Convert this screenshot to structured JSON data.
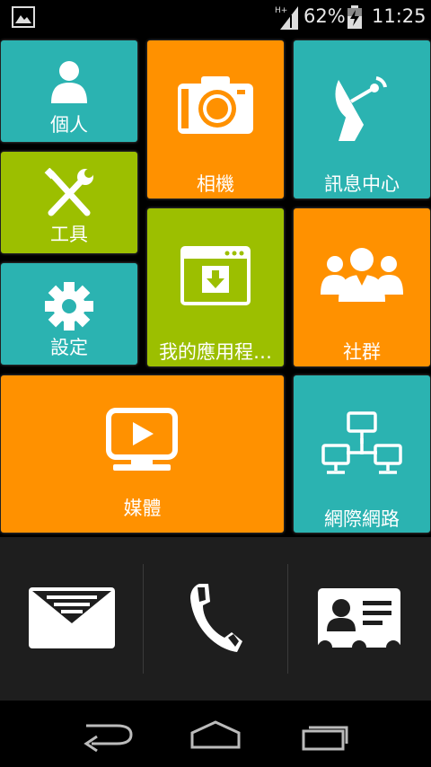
{
  "status_bar": {
    "network_type": "H+",
    "battery_percent": "62%",
    "time": "11:25"
  },
  "tiles": {
    "personal": {
      "label": "個人",
      "icon": "person-icon"
    },
    "camera": {
      "label": "相機",
      "icon": "camera-icon"
    },
    "messages": {
      "label": "訊息中心",
      "icon": "satellite-dish-icon"
    },
    "tools": {
      "label": "工具",
      "icon": "wrench-screwdriver-icon"
    },
    "my_apps": {
      "label": "我的應用程…",
      "icon": "download-window-icon"
    },
    "settings": {
      "label": "設定",
      "icon": "gear-icon"
    },
    "community": {
      "label": "社群",
      "icon": "group-icon"
    },
    "media": {
      "label": "媒體",
      "icon": "play-monitor-icon"
    },
    "network": {
      "label": "網際網路",
      "icon": "network-icon"
    }
  },
  "dock": {
    "items": [
      {
        "name": "messages",
        "icon": "envelope-icon"
      },
      {
        "name": "phone",
        "icon": "phone-icon"
      },
      {
        "name": "contacts",
        "icon": "contact-card-icon"
      }
    ]
  },
  "nav_bar": {
    "items": [
      "back-icon",
      "home-icon",
      "recents-icon"
    ]
  },
  "colors": {
    "teal": "#2bb3b1",
    "orange": "#ff9100",
    "green": "#9cbf00",
    "dock_bg": "#1e1e1e"
  }
}
